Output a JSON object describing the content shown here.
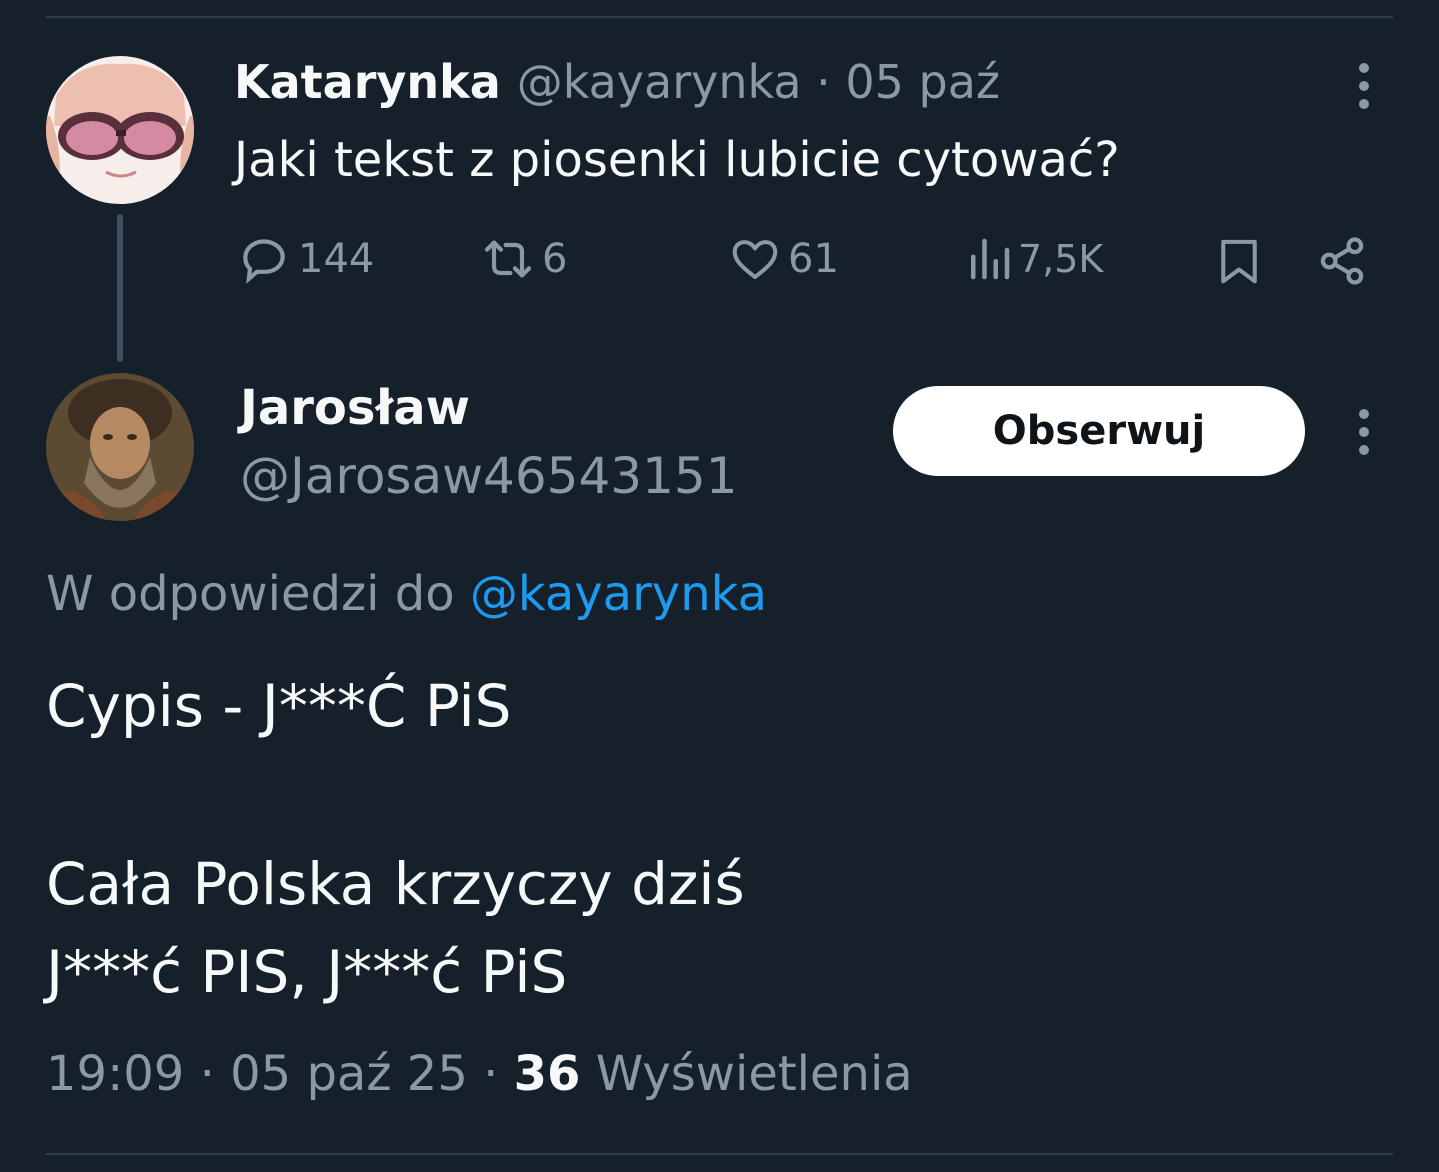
{
  "parent_tweet": {
    "author_name": "Katarynka",
    "meta": "@kayarynka · 05 paź",
    "text": "Jaki tekst z piosenki lubicie cytować?",
    "stats": {
      "replies": "144",
      "retweets": "6",
      "likes": "61",
      "views": "7,5K"
    }
  },
  "reply_tweet": {
    "author_name": "Jarosław",
    "handle": "@Jarosaw46543151",
    "follow_label": "Obserwuj",
    "reply_to_prefix": "W odpowiedzi do",
    "reply_to_handle": "@kayarynka",
    "lines": [
      "Cypis - J***Ć PiS",
      "Cała Polska krzyczy dziś",
      "J***ć PIS, J***ć PiS"
    ],
    "time": "19:09 · 05 paź 25 ·",
    "views_count": "36",
    "views_label": "Wyświetlenia"
  },
  "colors": {
    "background": "#15202b",
    "text_primary": "#f7f9f9",
    "text_secondary": "#8b98a5",
    "accent": "#1d9bf0"
  },
  "icons": [
    "more-icon",
    "reply-icon",
    "retweet-icon",
    "like-icon",
    "views-icon",
    "bookmark-icon",
    "share-icon"
  ]
}
